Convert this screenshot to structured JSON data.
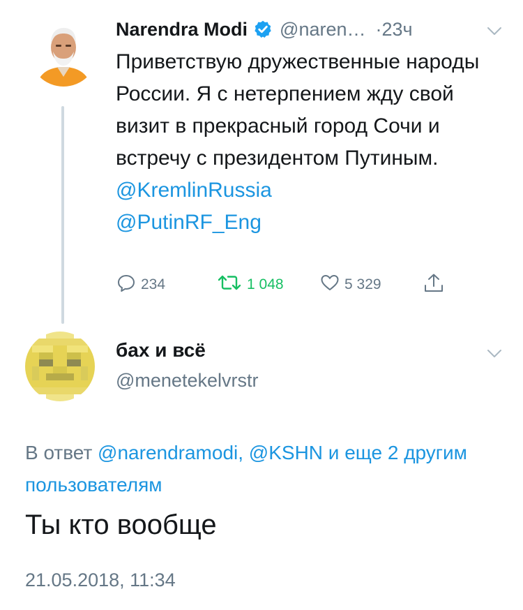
{
  "original_tweet": {
    "author_name": "Narendra Modi",
    "author_handle": "@naren…",
    "time": "·23ч",
    "text_plain": "Приветствую дружественные народы России. Я с нетерпением жду свой визит в прекрасный город Сочи и встречу с президентом Путиным. ",
    "mention_1": "@KremlinRussia",
    "mention_2": "@PutinRF_Eng",
    "replies": "234",
    "retweets": "1 048",
    "likes": "5 329"
  },
  "reply_tweet": {
    "author_name": "бах и всё",
    "author_handle": "@menetekelvrstr",
    "reply_prefix": "В ответ ",
    "reply_mentions": "@narendramodi, @KSHN и еще 2 другим пользователям",
    "text": "Ты кто вообще",
    "timestamp": "21.05.2018, 11:34"
  },
  "colors": {
    "link": "#1b95e0",
    "secondary_text": "#657786",
    "retweet_green": "#17bf63",
    "verified_blue": "#1da1f2"
  },
  "icons": [
    "verified-icon",
    "chevron-down-icon",
    "reply-icon",
    "retweet-icon",
    "like-icon",
    "share-icon"
  ]
}
